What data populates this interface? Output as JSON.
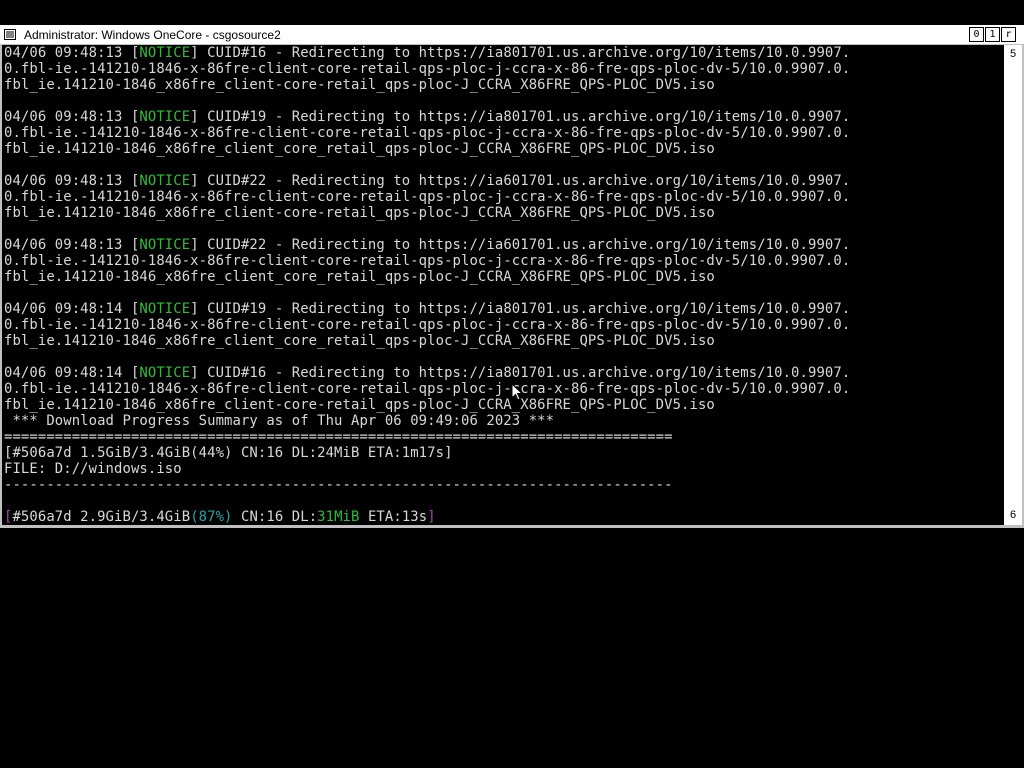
{
  "window": {
    "title": "Administrator:  Windows OneCore - csgosource2",
    "buttons": {
      "minimize": "0",
      "maximize": "1",
      "close": "r"
    }
  },
  "scrollbar": {
    "up": "5",
    "down": "6"
  },
  "log": [
    {
      "ts": "04/06 09:48:13 [",
      "lvl": "NOTICE",
      "rest": "] CUID#16 - Redirecting to https://ia801701.us.archive.org/10/items/10.0.9907.",
      "l2": "0.fbl-ie.-141210-1846-x-86fre-client-core-retail-qps-ploc-j-ccra-x-86-fre-qps-ploc-dv-5/10.0.9907.0.",
      "l3": "fbl_ie.141210-1846_x86fre_client-core-retail_qps-ploc-J_CCRA_X86FRE_QPS-PLOC_DV5.iso"
    },
    {
      "ts": "04/06 09:48:13 [",
      "lvl": "NOTICE",
      "rest": "] CUID#19 - Redirecting to https://ia801701.us.archive.org/10/items/10.0.9907.",
      "l2": "0.fbl-ie.-141210-1846-x-86fre-client-core-retail-qps-ploc-j-ccra-x-86-fre-qps-ploc-dv-5/10.0.9907.0.",
      "l3": "fbl_ie.141210-1846_x86fre_client_core_retail_qps-ploc-J_CCRA_X86FRE_QPS-PLOC_DV5.iso"
    },
    {
      "ts": "04/06 09:48:13 [",
      "lvl": "NOTICE",
      "rest": "] CUID#22 - Redirecting to https://ia601701.us.archive.org/10/items/10.0.9907.",
      "l2": "0.fbl-ie.-141210-1846-x-86fre-client-core-retail-qps-ploc-j-ccra-x-86-fre-qps-ploc-dv-5/10.0.9907.0.",
      "l3": "fbl_ie.141210-1846_x86fre_client-core-retail_qps-ploc-J_CCRA_X86FRE_QPS-PLOC_DV5.iso"
    },
    {
      "ts": "04/06 09:48:13 [",
      "lvl": "NOTICE",
      "rest": "] CUID#22 - Redirecting to https://ia601701.us.archive.org/10/items/10.0.9907.",
      "l2": "0.fbl-ie.-141210-1846-x-86fre-client-core-retail-qps-ploc-j-ccra-x-86-fre-qps-ploc-dv-5/10.0.9907.0.",
      "l3": "fbl_ie.141210-1846_x86fre_client_core_retail_qps-ploc-J_CCRA_X86FRE_QPS-PLOC_DV5.iso"
    },
    {
      "ts": "04/06 09:48:14 [",
      "lvl": "NOTICE",
      "rest": "] CUID#19 - Redirecting to https://ia801701.us.archive.org/10/items/10.0.9907.",
      "l2": "0.fbl-ie.-141210-1846-x-86fre-client-core-retail-qps-ploc-j-ccra-x-86-fre-qps-ploc-dv-5/10.0.9907.0.",
      "l3": "fbl_ie.141210-1846_x86fre_client_core_retail_qps-ploc-J_CCRA_X86FRE_QPS-PLOC_DV5.iso"
    },
    {
      "ts": "04/06 09:48:14 [",
      "lvl": "NOTICE",
      "rest": "] CUID#16 - Redirecting to https://ia801701.us.archive.org/10/items/10.0.9907.",
      "l2": "0.fbl-ie.-141210-1846-x-86fre-client-core-retail-qps-ploc-j-ccra-x-86-fre-qps-ploc-dv-5/10.0.9907.0.",
      "l3": "fbl_ie.141210-1846_x86fre_client-core-retail_qps-ploc-J_CCRA_X86FRE_QPS-PLOC_DV5.iso"
    }
  ],
  "summary": {
    "header": " *** Download Progress Summary as of Thu Apr 06 09:49:06 2023 ***",
    "rule_eq": "===============================================================================",
    "progress": "[#506a7d 1.5GiB/3.4GiB(44%) CN:16 DL:24MiB ETA:1m17s]",
    "file": "FILE: D://windows.iso",
    "rule_dash": "-------------------------------------------------------------------------------"
  },
  "status": {
    "open": "[",
    "a": "#506a7d 2.9GiB/3.4GiB",
    "pct": "(87%)",
    "b": " CN:16 DL:",
    "dl": "31MiB",
    "c": " ETA:13s",
    "close": "]"
  },
  "colors": {
    "notice": "#2fbf2f",
    "teal": "#2aa3a3",
    "purple": "#a04da0",
    "text": "#d8d8d8"
  }
}
